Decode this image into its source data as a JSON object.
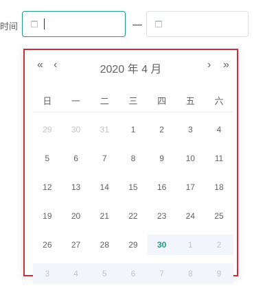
{
  "form": {
    "label": "时间",
    "separator": "—"
  },
  "calendar": {
    "title": "2020 年  4 月",
    "nav": {
      "prev_year": "«",
      "prev_month": "‹",
      "next_month": "›",
      "next_year": "»"
    },
    "weekdays": [
      "日",
      "一",
      "二",
      "三",
      "四",
      "五",
      "六"
    ],
    "weeks": [
      [
        {
          "d": "29",
          "t": "prev"
        },
        {
          "d": "30",
          "t": "prev"
        },
        {
          "d": "31",
          "t": "prev"
        },
        {
          "d": "1",
          "t": "cur"
        },
        {
          "d": "2",
          "t": "cur"
        },
        {
          "d": "3",
          "t": "cur"
        },
        {
          "d": "4",
          "t": "cur"
        }
      ],
      [
        {
          "d": "5",
          "t": "cur"
        },
        {
          "d": "6",
          "t": "cur"
        },
        {
          "d": "7",
          "t": "cur"
        },
        {
          "d": "8",
          "t": "cur"
        },
        {
          "d": "9",
          "t": "cur"
        },
        {
          "d": "10",
          "t": "cur"
        },
        {
          "d": "11",
          "t": "cur"
        }
      ],
      [
        {
          "d": "12",
          "t": "cur"
        },
        {
          "d": "13",
          "t": "cur"
        },
        {
          "d": "14",
          "t": "cur"
        },
        {
          "d": "15",
          "t": "cur"
        },
        {
          "d": "16",
          "t": "cur"
        },
        {
          "d": "17",
          "t": "cur"
        },
        {
          "d": "18",
          "t": "cur"
        }
      ],
      [
        {
          "d": "19",
          "t": "cur"
        },
        {
          "d": "20",
          "t": "cur"
        },
        {
          "d": "21",
          "t": "cur"
        },
        {
          "d": "22",
          "t": "cur"
        },
        {
          "d": "23",
          "t": "cur"
        },
        {
          "d": "24",
          "t": "cur"
        },
        {
          "d": "25",
          "t": "cur"
        }
      ],
      [
        {
          "d": "26",
          "t": "cur"
        },
        {
          "d": "27",
          "t": "cur"
        },
        {
          "d": "28",
          "t": "cur"
        },
        {
          "d": "29",
          "t": "cur"
        },
        {
          "d": "30",
          "t": "today"
        },
        {
          "d": "1",
          "t": "next_range"
        },
        {
          "d": "2",
          "t": "next_range"
        }
      ],
      [
        {
          "d": "3",
          "t": "next_range"
        },
        {
          "d": "4",
          "t": "next_range"
        },
        {
          "d": "5",
          "t": "next_range"
        },
        {
          "d": "6",
          "t": "next_range"
        },
        {
          "d": "7",
          "t": "next_range"
        },
        {
          "d": "8",
          "t": "next_range"
        },
        {
          "d": "9",
          "t": "next_range"
        }
      ]
    ]
  },
  "colors": {
    "accent": "#1c9c85",
    "panel_border": "#c4303a",
    "range_bg": "#f2f6fc"
  }
}
